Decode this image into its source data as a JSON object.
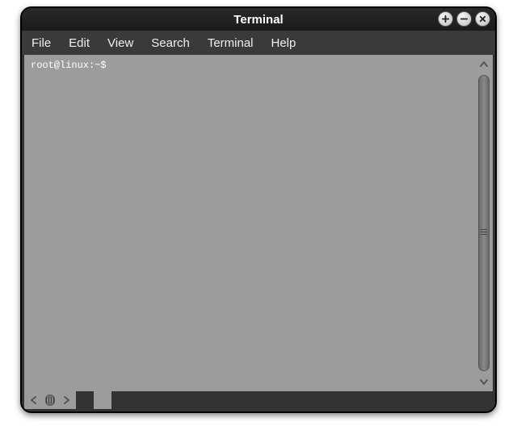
{
  "window": {
    "title": "Terminal"
  },
  "menubar": {
    "items": [
      {
        "label": "File"
      },
      {
        "label": "Edit"
      },
      {
        "label": "View"
      },
      {
        "label": "Search"
      },
      {
        "label": "Terminal"
      },
      {
        "label": "Help"
      }
    ]
  },
  "terminal": {
    "prompt": "root@linux:~$"
  }
}
